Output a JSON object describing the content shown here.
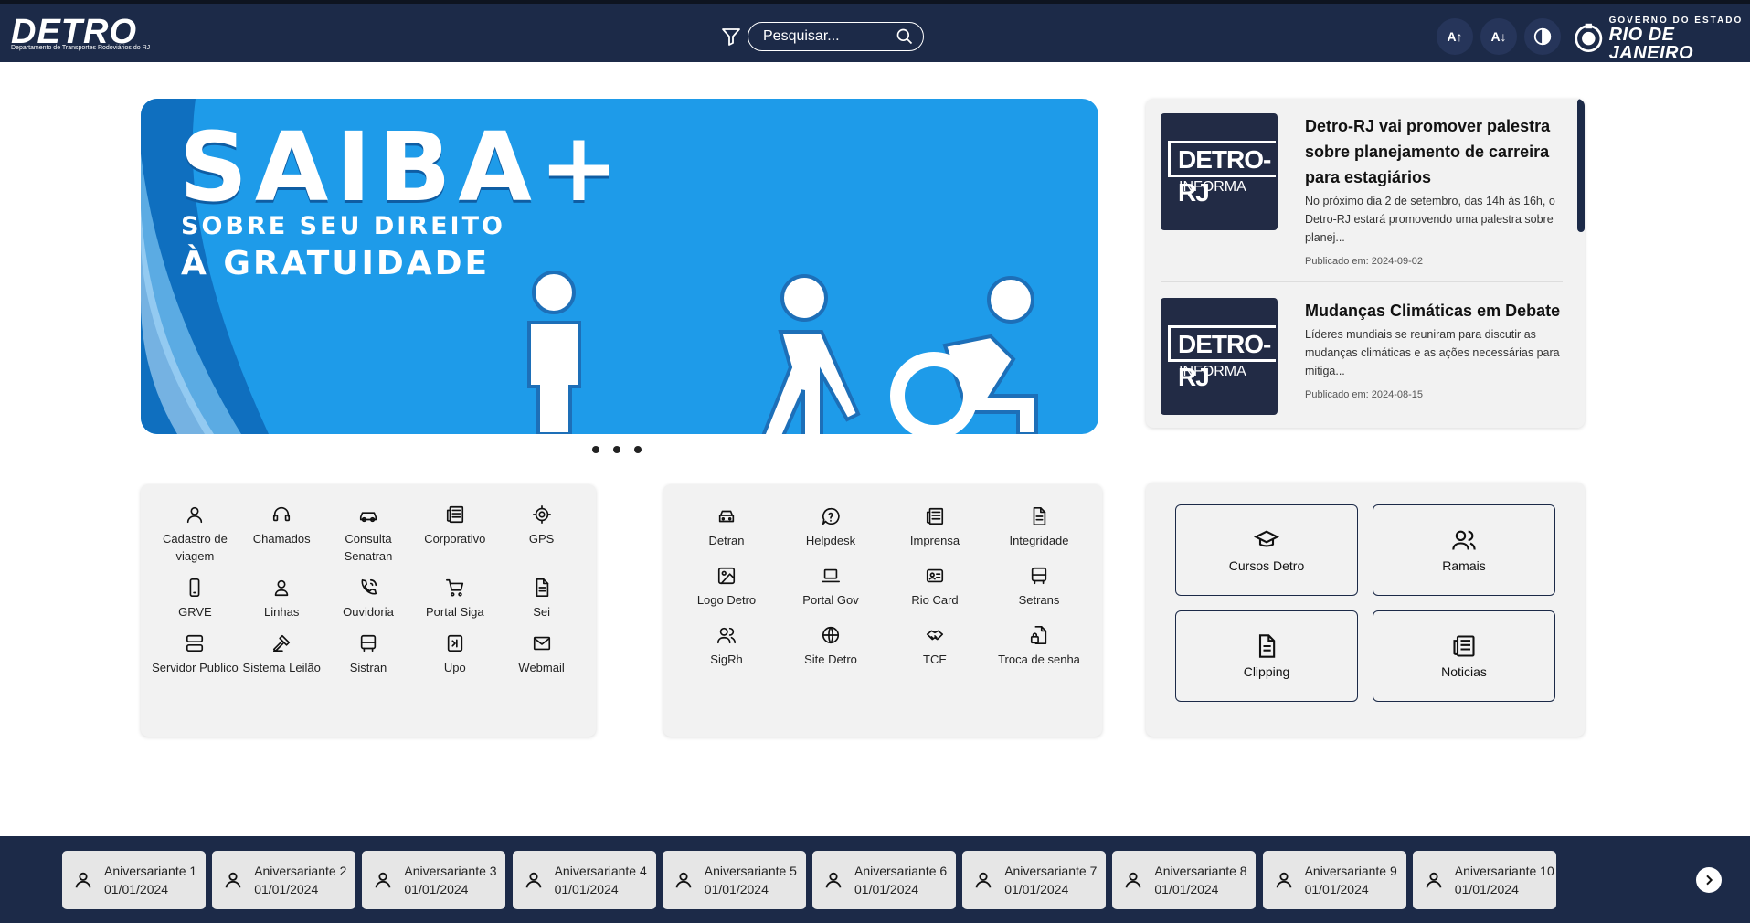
{
  "header": {
    "logo_text": "DETRO",
    "logo_subtitle": "Departamento de Transportes Rodoviários do RJ",
    "search_placeholder": "Pesquisar...",
    "font_increase_label": "A↑",
    "font_decrease_label": "A↓",
    "gov_line1": "GOVERNO DO ESTADO",
    "gov_line2": "RIO DE JANEIRO"
  },
  "banner": {
    "title": "SAIBA+",
    "subtitle_line1": "SOBRE SEU DIREITO",
    "subtitle_line2": "À GRATUIDADE",
    "slides": 3
  },
  "news": [
    {
      "image_line1": "DETRO-RJ",
      "image_line2": "INFORMA",
      "title": "Detro-RJ vai promover palestra sobre planejamento de carreira para estagiários",
      "description": "No próximo dia 2 de setembro, das 14h às 16h, o Detro-RJ estará promovendo uma palestra sobre planej...",
      "date": "Publicado em: 2024-09-02"
    },
    {
      "image_line1": "DETRO-RJ",
      "image_line2": "INFORMA",
      "title": "Mudanças Climáticas em Debate",
      "description": "Líderes mundiais se reuniram para discutir as mudanças climáticas e as ações necessárias para mitiga...",
      "date": "Publicado em: 2024-08-15"
    }
  ],
  "services_left": [
    {
      "label": "Cadastro de viagem",
      "icon": "user-icon"
    },
    {
      "label": "Chamados",
      "icon": "headset-icon"
    },
    {
      "label": "Consulta Senatran",
      "icon": "car-icon"
    },
    {
      "label": "Corporativo",
      "icon": "newspaper-icon"
    },
    {
      "label": "GPS",
      "icon": "target-icon"
    },
    {
      "label": "GRVE",
      "icon": "phone-icon"
    },
    {
      "label": "Linhas",
      "icon": "user-pin-icon"
    },
    {
      "label": "Ouvidoria",
      "icon": "phone-call-icon"
    },
    {
      "label": "Portal Siga",
      "icon": "cart-icon"
    },
    {
      "label": "Sei",
      "icon": "document-icon"
    },
    {
      "label": "Servidor Publico",
      "icon": "server-icon"
    },
    {
      "label": "Sistema Leilão",
      "icon": "gavel-icon"
    },
    {
      "label": "Sistran",
      "icon": "bus-icon"
    },
    {
      "label": "Upo",
      "icon": "exit-icon"
    },
    {
      "label": "Webmail",
      "icon": "mail-icon"
    }
  ],
  "services_middle": [
    {
      "label": "Detran",
      "icon": "car-front-icon"
    },
    {
      "label": "Helpdesk",
      "icon": "help-bubble-icon"
    },
    {
      "label": "Imprensa",
      "icon": "newspaper-icon"
    },
    {
      "label": "Integridade",
      "icon": "document-icon"
    },
    {
      "label": "Logo Detro",
      "icon": "image-icon"
    },
    {
      "label": "Portal Gov",
      "icon": "laptop-icon"
    },
    {
      "label": "Rio Card",
      "icon": "id-card-icon"
    },
    {
      "label": "Setrans",
      "icon": "bus-icon"
    },
    {
      "label": "SigRh",
      "icon": "users-icon"
    },
    {
      "label": "Site Detro",
      "icon": "globe-icon"
    },
    {
      "label": "TCE",
      "icon": "handshake-icon"
    },
    {
      "label": "Troca de senha",
      "icon": "file-lock-icon"
    }
  ],
  "quick_links": [
    {
      "label": "Cursos Detro",
      "icon": "graduation-cap-icon"
    },
    {
      "label": "Ramais",
      "icon": "users-icon"
    },
    {
      "label": "Clipping",
      "icon": "document-icon"
    },
    {
      "label": "Noticias",
      "icon": "newspaper-icon"
    }
  ],
  "birthdays": [
    {
      "name": "Aniversariante 1",
      "date": "01/01/2024"
    },
    {
      "name": "Aniversariante 2",
      "date": "01/01/2024"
    },
    {
      "name": "Aniversariante 3",
      "date": "01/01/2024"
    },
    {
      "name": "Aniversariante 4",
      "date": "01/01/2024"
    },
    {
      "name": "Aniversariante 5",
      "date": "01/01/2024"
    },
    {
      "name": "Aniversariante 6",
      "date": "01/01/2024"
    },
    {
      "name": "Aniversariante 7",
      "date": "01/01/2024"
    },
    {
      "name": "Aniversariante 8",
      "date": "01/01/2024"
    },
    {
      "name": "Aniversariante 9",
      "date": "01/01/2024"
    },
    {
      "name": "Aniversariante 10",
      "date": "01/01/2024"
    }
  ],
  "colors": {
    "header_bg": "#1c2a48",
    "banner_bg": "#1e9be9",
    "panel_bg": "#f2f2f2"
  }
}
